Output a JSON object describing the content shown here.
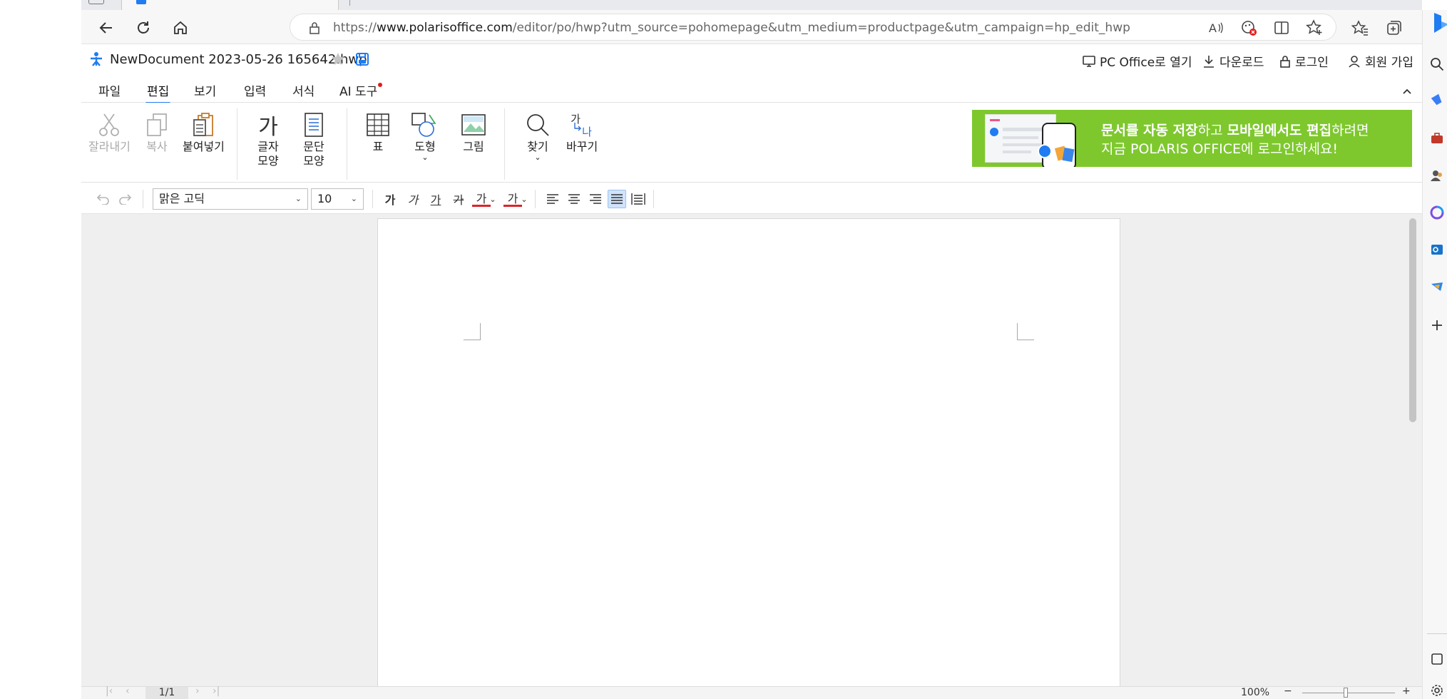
{
  "browser": {
    "url_prefix": "https://",
    "url_host": "www.polarisoffice.com",
    "url_path": "/editor/po/hwp?utm_source=pohomepage&utm_medium=productpage&utm_campaign=hp_edit_hwp"
  },
  "app": {
    "doc_title": "NewDocument 2023-05-26 165642.hwp",
    "header_links": {
      "pc_office": "PC Office로 열기",
      "download": "다운로드",
      "login": "로그인",
      "signup": "회원 가입"
    }
  },
  "menu": {
    "tabs": [
      "파일",
      "편집",
      "보기",
      "입력",
      "서식",
      "AI 도구"
    ],
    "active": "편집"
  },
  "ribbon": {
    "cut": "잘라내기",
    "copy": "복사",
    "paste": "붙여넣기",
    "char_shape_icon": "가",
    "char_shape_1": "글자",
    "char_shape_2": "모양",
    "para_shape_1": "문단",
    "para_shape_2": "모양",
    "table": "표",
    "shape": "도형",
    "picture": "그림",
    "find": "찾기",
    "replace": "바꾸기",
    "replace_icon_top": "가",
    "replace_icon_bottom": "나"
  },
  "banner": {
    "line1_part1": "문서를 자동 저장",
    "line1_part2": "하고 ",
    "line1_part3": "모바일에서도 편집",
    "line1_part4": "하려면",
    "line2": "지금 POLARIS OFFICE에 로그인하세요!",
    "color": "#7ec82e"
  },
  "format_bar": {
    "font_name": "맑은 고딕",
    "font_size": "10",
    "bold": "가",
    "italic": "가",
    "underline": "가",
    "strike": "가",
    "font_color": "가",
    "highlight": "가"
  },
  "status": {
    "page": "1/1",
    "zoom": "100%"
  },
  "colors": {
    "accent": "#1f7cf2",
    "banner": "#7ec82e",
    "notice_dot": "#e21b1b"
  }
}
